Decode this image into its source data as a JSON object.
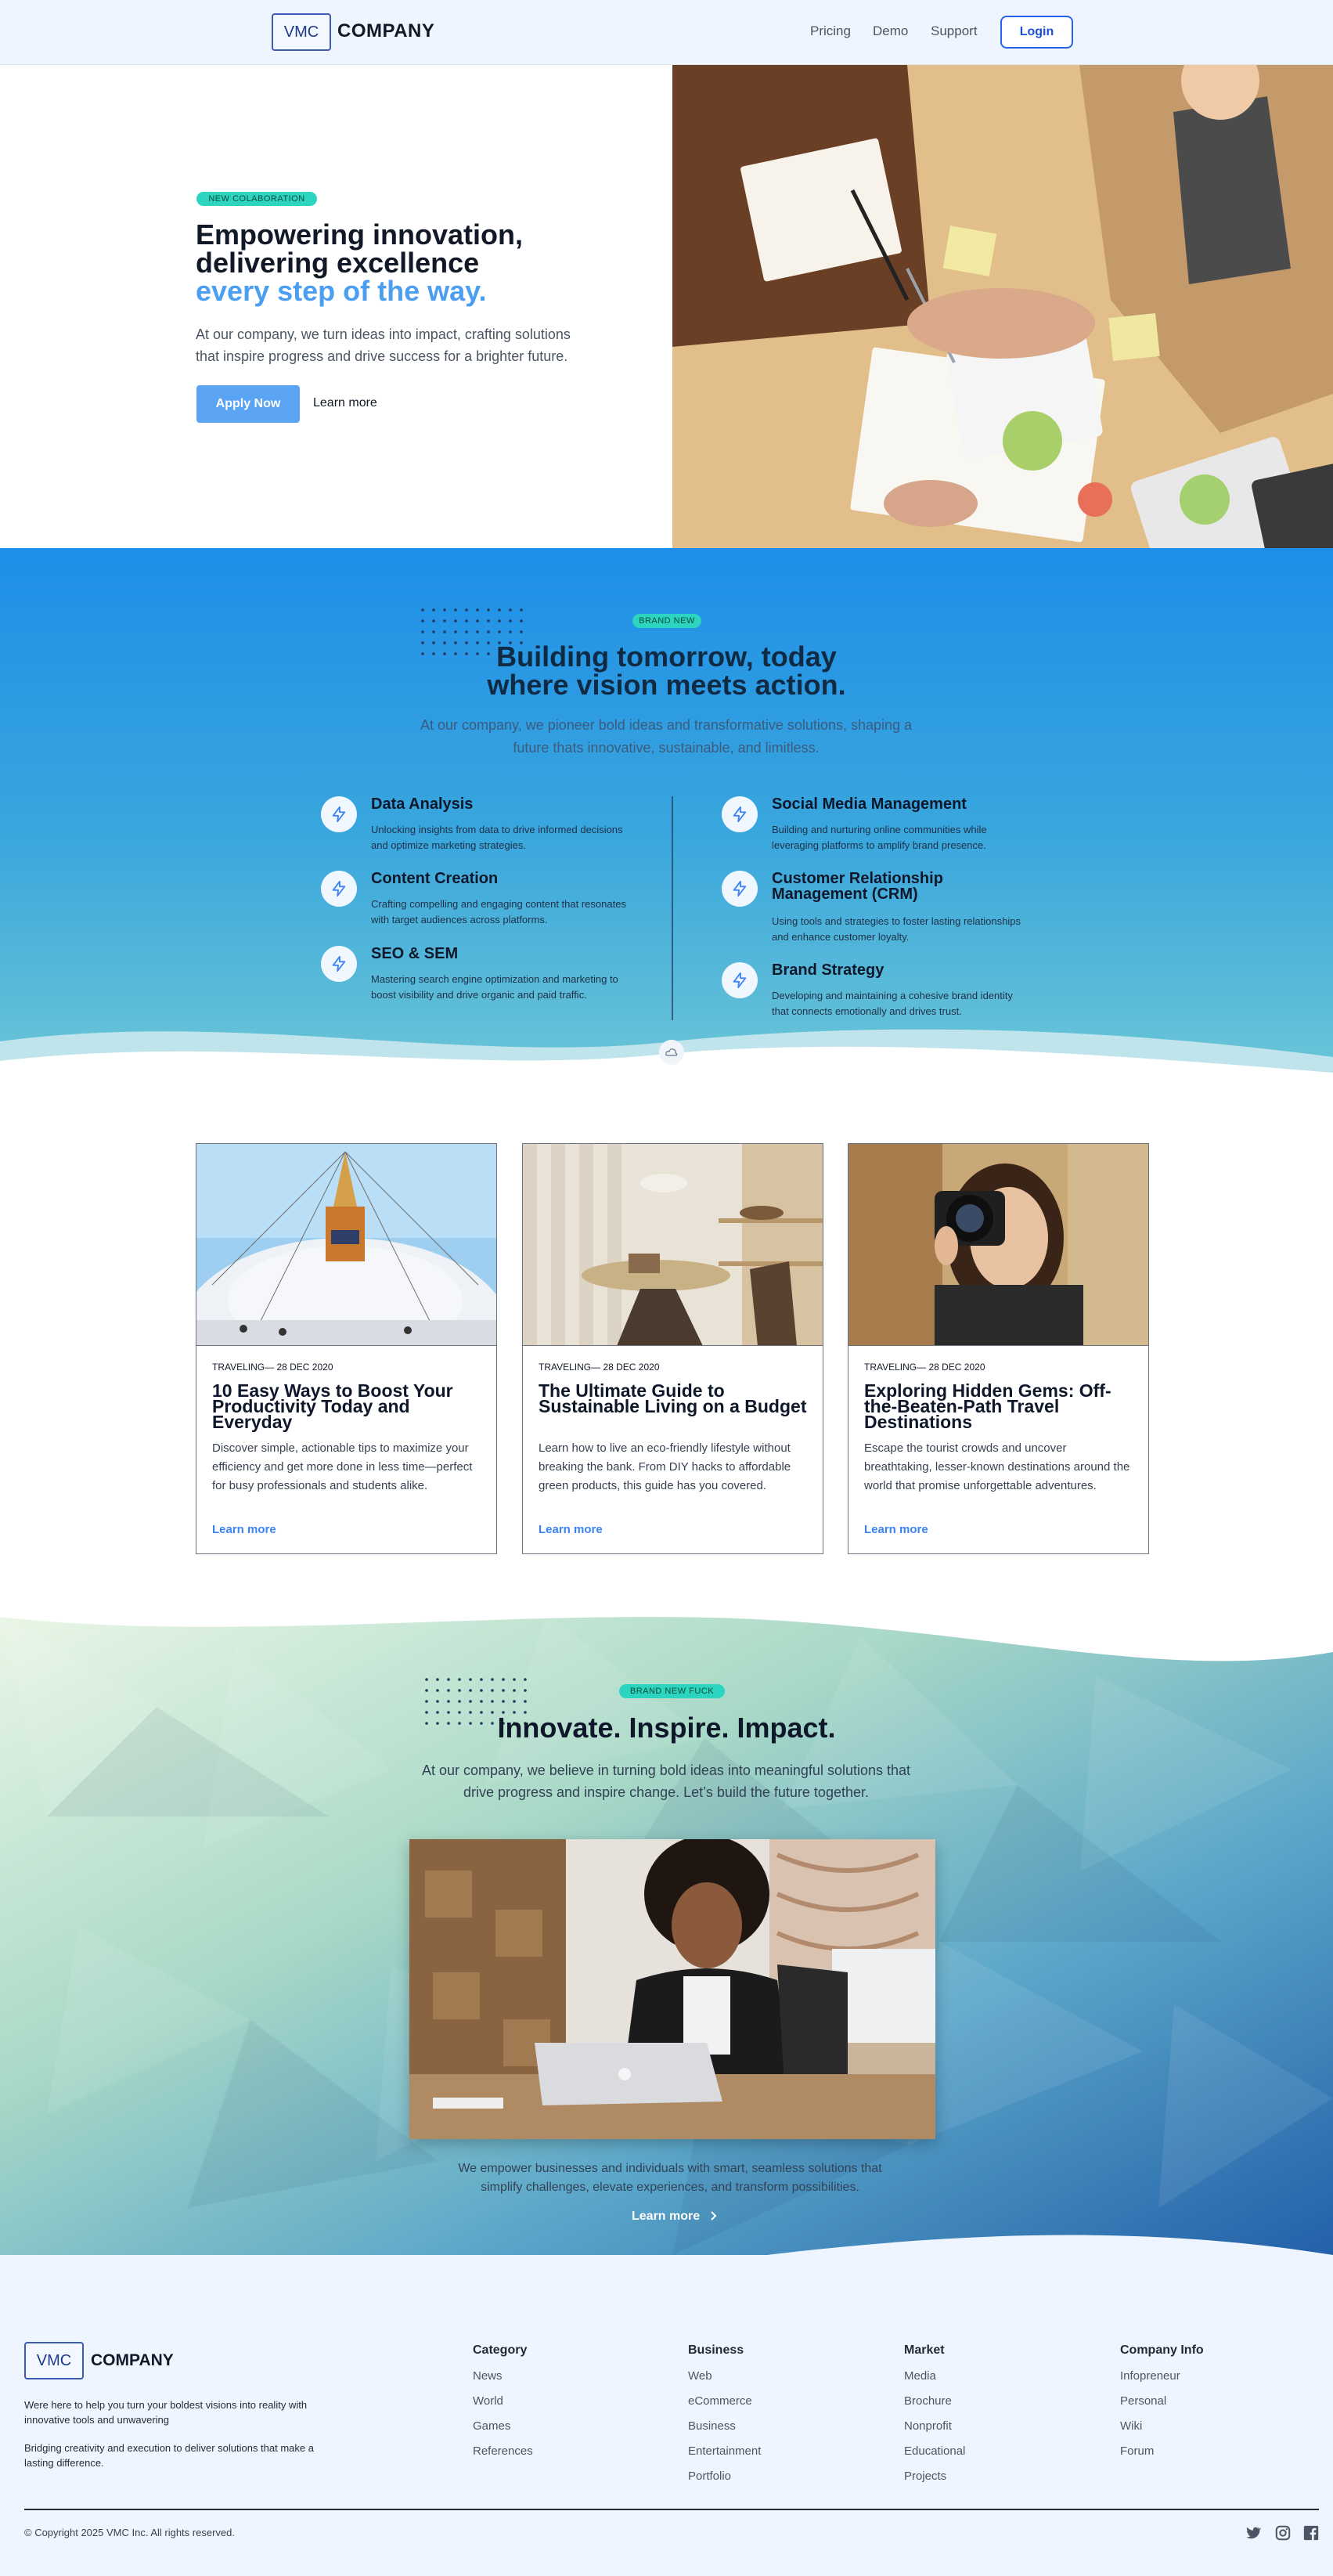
{
  "header": {
    "logo_box": "VMC",
    "logo_text": "COMPANY",
    "nav": [
      "Pricing",
      "Demo",
      "Support"
    ],
    "login": "Login"
  },
  "hero": {
    "badge": "NEW COLABORATION",
    "title_line1": "Empowering innovation,",
    "title_line2": "delivering excellence",
    "title_accent": "every step of the way.",
    "description": "At our company, we turn ideas into impact, crafting solutions that inspire progress and drive success for a brighter future.",
    "apply_button": "Apply Now",
    "learn_more": "Learn more"
  },
  "services": {
    "badge": "BRAND NEW",
    "title_line1": "Building tomorrow, today",
    "title_line2": "where vision meets action.",
    "description": "At our company, we pioneer bold ideas and transformative solutions, shaping a future thats innovative, sustainable, and limitless.",
    "items": [
      {
        "name": "Data Analysis",
        "text": "Unlocking insights from data to drive informed decisions and optimize marketing strategies."
      },
      {
        "name": "Content Creation",
        "text": "Crafting compelling and engaging content that resonates with target audiences across platforms."
      },
      {
        "name": "SEO & SEM",
        "text": "Mastering search engine optimization and marketing to boost visibility and drive organic and paid traffic."
      },
      {
        "name": "Social Media Management",
        "text": "Building and nurturing online communities while leveraging platforms to amplify brand presence."
      },
      {
        "name": "Customer Relationship Management (CRM)",
        "text": "Using tools and strategies to foster lasting relationships and enhance customer loyalty."
      },
      {
        "name": "Brand Strategy",
        "text": "Developing and maintaining a cohesive brand identity that connects emotionally and drives trust."
      }
    ]
  },
  "cards": [
    {
      "category": "TRAVELING",
      "date": "— 28 DEC 2020",
      "title": "10 Easy Ways to Boost Your Productivity Today and Everyday",
      "text": "Discover simple, actionable tips to maximize your efficiency and get more done in less time—perfect for busy professionals and students alike.",
      "link": "Learn more"
    },
    {
      "category": "TRAVELING",
      "date": "— 28 DEC 2020",
      "title": "The Ultimate Guide to Sustainable Living on a Budget",
      "text": "Learn how to live an eco-friendly lifestyle without breaking the bank. From DIY hacks to affordable green products, this guide has you covered.",
      "link": "Learn more"
    },
    {
      "category": "TRAVELING",
      "date": "— 28 DEC 2020",
      "title": "Exploring Hidden Gems: Off-the-Beaten-Path Travel Destinations",
      "text": "Escape the tourist crowds and uncover breathtaking, lesser-known destinations around the world that promise unforgettable adventures.",
      "link": "Learn more"
    }
  ],
  "innovate": {
    "badge": "BRAND NEW FUCK",
    "title": "Innovate. Inspire. Impact.",
    "description": "At our company, we believe in turning bold ideas into meaningful solutions that drive progress and inspire change. Let’s build the future together.",
    "subtext": "We empower businesses and individuals with smart, seamless solutions that simplify challenges, elevate experiences, and transform possibilities.",
    "learn_more": "Learn more"
  },
  "footer": {
    "logo_box": "VMC",
    "logo_text": "COMPANY",
    "desc1": "Were here to help you turn your boldest visions into reality with innovative tools and unwavering",
    "desc2": "Bridging creativity and execution to deliver solutions that make a lasting difference.",
    "columns": [
      {
        "title": "Category",
        "items": [
          "News",
          "World",
          "Games",
          "References"
        ]
      },
      {
        "title": "Business",
        "items": [
          "Web",
          "eCommerce",
          "Business",
          "Entertainment",
          "Portfolio"
        ]
      },
      {
        "title": "Market",
        "items": [
          "Media",
          "Brochure",
          "Nonprofit",
          "Educational",
          "Projects"
        ]
      },
      {
        "title": "Company Info",
        "items": [
          "Infopreneur",
          "Personal",
          "Wiki",
          "Forum"
        ]
      }
    ],
    "copyright": "© Copyright 2025 VMC Inc. All rights reserved.",
    "social": [
      "twitter-icon",
      "instagram-icon",
      "facebook-icon"
    ]
  },
  "colors": {
    "accent": "#4b9ef0",
    "badge": "#2dd4bf",
    "button": "#5aa4f3",
    "link": "#3b82f6"
  }
}
